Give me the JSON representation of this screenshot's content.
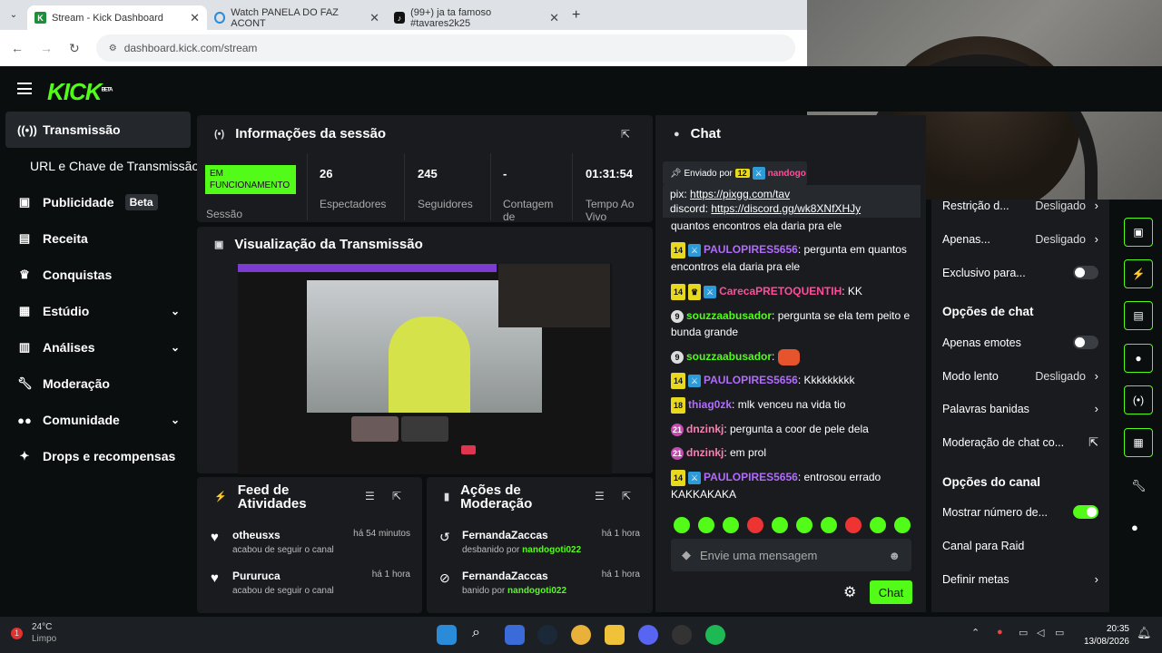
{
  "browser": {
    "tabs": [
      {
        "label": "Stream - Kick Dashboard"
      },
      {
        "label": "Watch PANELA DO FAZ ACONT"
      },
      {
        "label": "(99+) ja ta famoso #tavares2k25"
      }
    ],
    "url": "dashboard.kick.com/stream"
  },
  "brand": {
    "logo": "KICK",
    "beta": "BETA",
    "accent": "#53fc18"
  },
  "sidebar": {
    "items": [
      {
        "label": "Transmissão",
        "icon": "broadcast-icon"
      },
      {
        "label": "URL e Chave de Transmissão"
      },
      {
        "label": "Publicidade",
        "badge": "Beta",
        "icon": "ad-icon"
      },
      {
        "label": "Receita",
        "icon": "chart-icon"
      },
      {
        "label": "Conquistas",
        "icon": "trophy-icon"
      },
      {
        "label": "Estúdio",
        "icon": "layout-icon"
      },
      {
        "label": "Análises",
        "icon": "analytics-icon"
      },
      {
        "label": "Moderação",
        "icon": "wrench-icon"
      },
      {
        "label": "Comunidade",
        "icon": "users-icon"
      },
      {
        "label": "Drops e recompensas",
        "icon": "gift-icon"
      }
    ]
  },
  "session": {
    "title": "Informações da sessão",
    "status": "EM FUNCIONAMENTO",
    "status_label": "Sessão",
    "stats": [
      {
        "value": "26",
        "label": "Espectadores"
      },
      {
        "value": "245",
        "label": "Seguidores"
      },
      {
        "value": "-",
        "label": "Contagem de"
      },
      {
        "value": "01:31:54",
        "label": "Tempo Ao Vivo"
      }
    ]
  },
  "preview": {
    "title": "Visualização da Transmissão"
  },
  "feed": {
    "title": "Feed de Atividades",
    "rows": [
      {
        "name": "otheusxs",
        "sub": "acabou de seguir o canal",
        "time": "há 54 minutos"
      },
      {
        "name": "Pururuca",
        "sub": "acabou de seguir o canal",
        "time": "há 1 hora"
      }
    ]
  },
  "modactions": {
    "title": "Ações de Moderação",
    "rows": [
      {
        "name": "FernandaZaccas",
        "action": "desbanido por",
        "by": "nandogoti022",
        "time": "há 1 hora"
      },
      {
        "name": "FernandaZaccas",
        "action": "banido por",
        "by": "nandogoti022",
        "time": "há 1 hora"
      }
    ]
  },
  "chat": {
    "title": "Chat",
    "pinned_by": "Enviado por",
    "pinned_user": "nandogo",
    "pinned_pix_label": "pix:",
    "pinned_pix": "https://pixgg.com/tav",
    "pinned_discord_label": "discord:",
    "pinned_discord": "https://discord.gg/wk8XNfXHJy",
    "partial_line": "quantos encontros ela daria pra ele",
    "messages": [
      {
        "level": "14",
        "user": "PAULOPIRES5656",
        "text": ": pergunta em quantos encontros ela daria pra ele"
      },
      {
        "level": "14",
        "user": "CarecaPRETOQUENTIH",
        "text": ": KK"
      },
      {
        "level": "9",
        "user": "souzzaabusador",
        "text": ": pergunta se ela tem peito e bunda grande"
      },
      {
        "level": "9",
        "user": "souzzaabusador",
        "text": ":"
      },
      {
        "level": "14",
        "user": "PAULOPIRES5656",
        "text": ": Kkkkkkkkk"
      },
      {
        "level": "18",
        "user": "thiag0zk",
        "text": ": mlk venceu na vida tio"
      },
      {
        "level": "21",
        "user": "dnzinkj",
        "text": ": pergunta a coor de pele dela"
      },
      {
        "level": "21",
        "user": "dnzinkj",
        "text": ": em prol"
      },
      {
        "level": "14",
        "user": "PAULOPIRES5656",
        "text": ": entrosou errado KAKKAKAKA"
      }
    ],
    "input_placeholder": "Envie uma mensagem",
    "send_label": "Chat"
  },
  "settings": {
    "rows": [
      {
        "label": "Restrição d...",
        "value": "Desligado"
      },
      {
        "label": "Apenas...",
        "value": "Desligado"
      },
      {
        "label": "Exclusivo para..."
      }
    ],
    "chat_options_title": "Opções de chat",
    "chat_options": [
      {
        "label": "Apenas emotes"
      },
      {
        "label": "Modo lento",
        "value": "Desligado"
      },
      {
        "label": "Palavras banidas"
      },
      {
        "label": "Moderação de chat co..."
      }
    ],
    "channel_options_title": "Opções do canal",
    "channel_options": [
      {
        "label": "Mostrar número de..."
      },
      {
        "label": "Canal para Raid"
      },
      {
        "label": "Definir metas"
      }
    ]
  },
  "taskbar": {
    "temp": "24°C",
    "weather": "Limpo",
    "notif": "1",
    "time": "20:35",
    "date": "13/08/2026"
  }
}
